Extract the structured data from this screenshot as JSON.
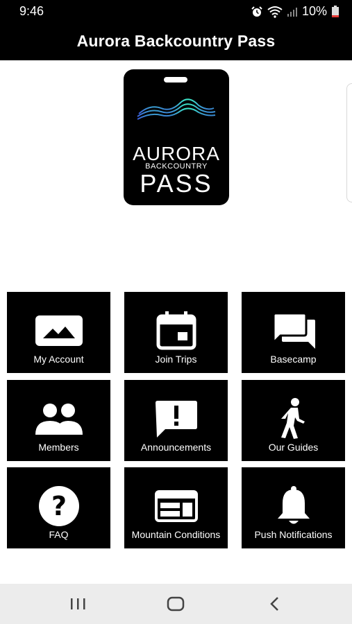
{
  "status_bar": {
    "time": "9:46",
    "battery": "10%",
    "icons": [
      "alarm-icon",
      "wifi-icon",
      "signal-icon",
      "battery-icon"
    ]
  },
  "app_bar": {
    "title": "Aurora Backcountry Pass"
  },
  "logo": {
    "line1": "AURORA",
    "line2": "BACKCOUNTRY",
    "line3": "PASS",
    "wave_color": "#2fd3c3"
  },
  "tiles": [
    {
      "label": "My Account",
      "icon": "image-icon"
    },
    {
      "label": "Join Trips",
      "icon": "calendar-icon"
    },
    {
      "label": "Basecamp",
      "icon": "chat-bubbles-icon"
    },
    {
      "label": "Members",
      "icon": "people-icon"
    },
    {
      "label": "Announcements",
      "icon": "alert-message-icon"
    },
    {
      "label": "Our Guides",
      "icon": "walking-person-icon"
    },
    {
      "label": "FAQ",
      "icon": "question-icon"
    },
    {
      "label": "Mountain Conditions",
      "icon": "web-page-icon"
    },
    {
      "label": "Push Notifications",
      "icon": "bell-icon"
    }
  ],
  "nav_bar": {
    "buttons": [
      "recents-icon",
      "home-icon",
      "back-icon"
    ]
  },
  "colors": {
    "tile_background": "#000000",
    "app_bar_background": "#000000",
    "nav_bar_background": "#ececec"
  }
}
